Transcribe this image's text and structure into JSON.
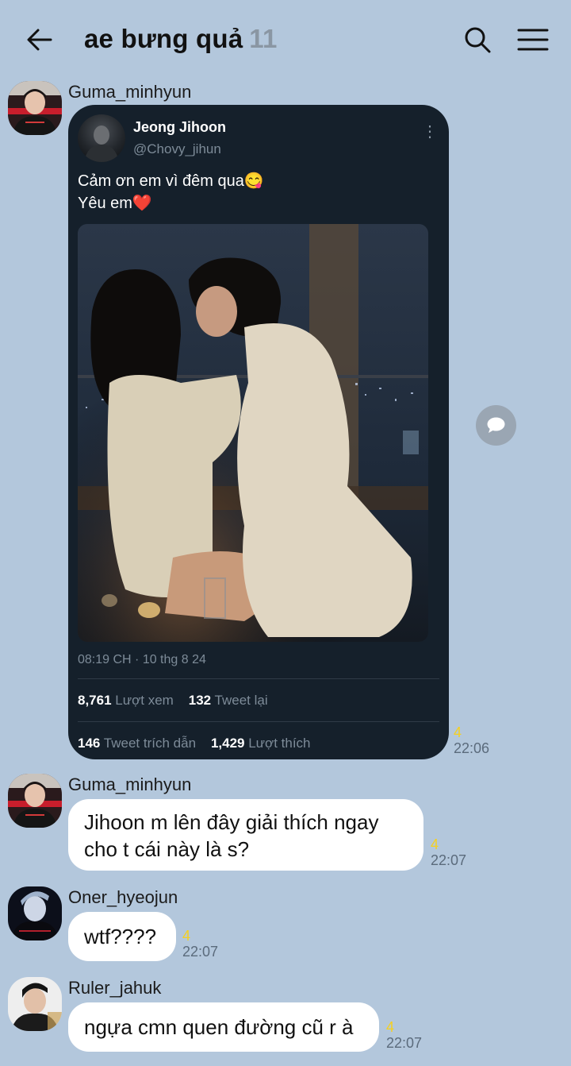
{
  "header": {
    "title": "ae bưng quả",
    "member_count": "11"
  },
  "messages": [
    {
      "sender": "Guma_minhyun",
      "tweet": {
        "name": "Jeong Jihoon",
        "handle": "@Chovy_jihun",
        "text_line1": "Cảm ơn em vì đêm qua😋",
        "text_line2": "Yêu em❤️",
        "date": "08:19 CH · 10 thg 8 24",
        "views_count": "8,761",
        "views_label": "Lượt xem",
        "retweets_count": "132",
        "retweets_label": "Tweet lại",
        "quotes_count": "146",
        "quotes_label": "Tweet trích dẫn",
        "likes_count": "1,429",
        "likes_label": "Lượt thích"
      },
      "unread": "4",
      "time": "22:06"
    },
    {
      "sender": "Guma_minhyun",
      "text_line1": "Jihoon m lên đây giải thích ngay",
      "text_line2": "cho t cái này là s?",
      "unread": "4",
      "time": "22:07"
    },
    {
      "sender": "Oner_hyeojun",
      "text": "wtf????",
      "unread": "4",
      "time": "22:07"
    },
    {
      "sender": "Ruler_jahuk",
      "text": "ngựa cmn quen đường cũ r à",
      "unread": "4",
      "time": "22:07"
    }
  ],
  "colors": {
    "background": "#b3c7dc",
    "tweet_card": "#15202b",
    "unread": "#f5d020"
  }
}
